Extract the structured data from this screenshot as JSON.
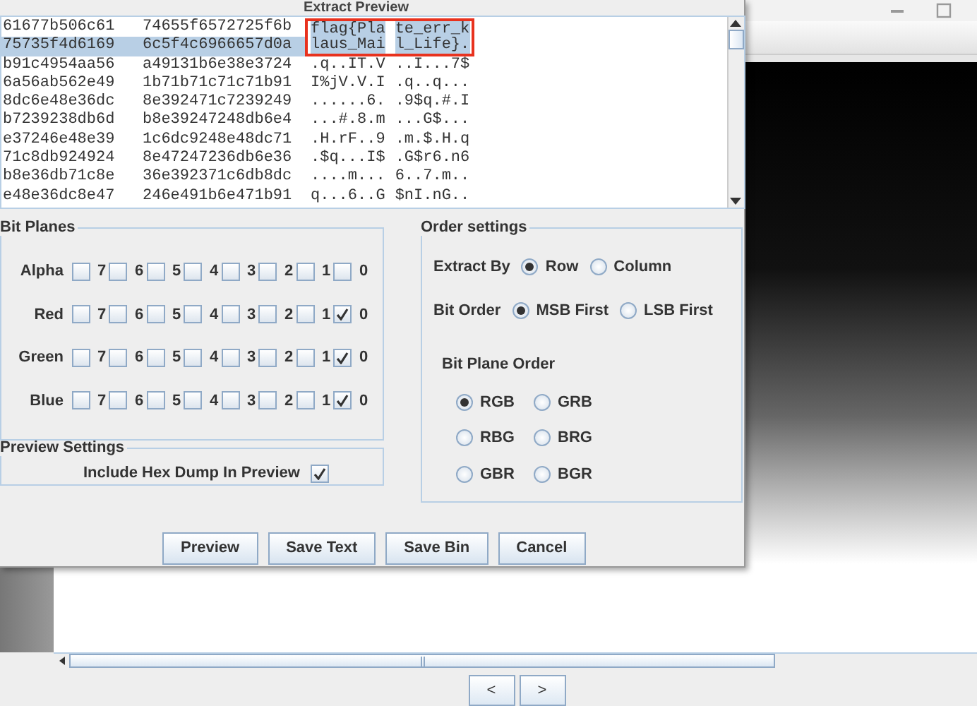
{
  "extract_preview": {
    "title": "Extract Preview",
    "rows": [
      {
        "hex_1": "61677b506c61",
        "hex_2": "74655f6572725f6b",
        "ascii_1": "flag{Pla",
        "ascii_2": "te_err_k",
        "hex_selected": false,
        "ascii_selected": true,
        "annotated": true
      },
      {
        "hex_1": "75735f4d6169",
        "hex_2": "6c5f4c6966657d0a",
        "ascii_1": "laus_Mai",
        "ascii_2": "l_Life}.",
        "hex_selected": true,
        "ascii_selected": true,
        "annotated": true
      },
      {
        "hex_1": "b91c4954aa56",
        "hex_2": "a49131b6e38e3724",
        "ascii_1": ".q..IT.V",
        "ascii_2": "..I...7$",
        "hex_selected": false,
        "ascii_selected": false,
        "annotated": false
      },
      {
        "hex_1": "6a56ab562e49",
        "hex_2": "1b71b71c71c71b91",
        "ascii_1": "I%jV.V.I",
        "ascii_2": ".q..q...",
        "hex_selected": false,
        "ascii_selected": false,
        "annotated": false
      },
      {
        "hex_1": "8dc6e48e36dc",
        "hex_2": "8e392471c7239249",
        "ascii_1": "......6.",
        "ascii_2": ".9$q.#.I",
        "hex_selected": false,
        "ascii_selected": false,
        "annotated": false
      },
      {
        "hex_1": "b7239238db6d",
        "hex_2": "b8e39247248db6e4",
        "ascii_1": "...#.8.m",
        "ascii_2": "...G$...",
        "hex_selected": false,
        "ascii_selected": false,
        "annotated": false
      },
      {
        "hex_1": "e37246e48e39",
        "hex_2": "1c6dc9248e48dc71",
        "ascii_1": ".H.rF..9",
        "ascii_2": ".m.$.H.q",
        "hex_selected": false,
        "ascii_selected": false,
        "annotated": false
      },
      {
        "hex_1": "71c8db924924",
        "hex_2": "8e47247236db6e36",
        "ascii_1": ".$q...I$",
        "ascii_2": ".G$r6.n6",
        "hex_selected": false,
        "ascii_selected": false,
        "annotated": false
      },
      {
        "hex_1": "b8e36db71c8e",
        "hex_2": "36e392371c6db8dc",
        "ascii_1": "....m...",
        "ascii_2": "6..7.m..",
        "hex_selected": false,
        "ascii_selected": false,
        "annotated": false
      },
      {
        "hex_1": "e48e36dc8e47",
        "hex_2": "246e491b6e471b91",
        "ascii_1": "q...6..G",
        "ascii_2": "$nI.nG..",
        "hex_selected": false,
        "ascii_selected": false,
        "annotated": false
      }
    ]
  },
  "bit_planes": {
    "title": "Bit Planes",
    "channels": [
      {
        "name": "Alpha",
        "bits": [
          {
            "label": "7",
            "checked": false
          },
          {
            "label": "6",
            "checked": false
          },
          {
            "label": "5",
            "checked": false
          },
          {
            "label": "4",
            "checked": false
          },
          {
            "label": "3",
            "checked": false
          },
          {
            "label": "2",
            "checked": false
          },
          {
            "label": "1",
            "checked": false
          },
          {
            "label": "0",
            "checked": false
          }
        ]
      },
      {
        "name": "Red",
        "bits": [
          {
            "label": "7",
            "checked": false
          },
          {
            "label": "6",
            "checked": false
          },
          {
            "label": "5",
            "checked": false
          },
          {
            "label": "4",
            "checked": false
          },
          {
            "label": "3",
            "checked": false
          },
          {
            "label": "2",
            "checked": false
          },
          {
            "label": "1",
            "checked": false
          },
          {
            "label": "0",
            "checked": true
          }
        ]
      },
      {
        "name": "Green",
        "bits": [
          {
            "label": "7",
            "checked": false
          },
          {
            "label": "6",
            "checked": false
          },
          {
            "label": "5",
            "checked": false
          },
          {
            "label": "4",
            "checked": false
          },
          {
            "label": "3",
            "checked": false
          },
          {
            "label": "2",
            "checked": false
          },
          {
            "label": "1",
            "checked": false
          },
          {
            "label": "0",
            "checked": true
          }
        ]
      },
      {
        "name": "Blue",
        "bits": [
          {
            "label": "7",
            "checked": false
          },
          {
            "label": "6",
            "checked": false
          },
          {
            "label": "5",
            "checked": false
          },
          {
            "label": "4",
            "checked": false
          },
          {
            "label": "3",
            "checked": false
          },
          {
            "label": "2",
            "checked": false
          },
          {
            "label": "1",
            "checked": false
          },
          {
            "label": "0",
            "checked": true
          }
        ]
      }
    ]
  },
  "preview_settings": {
    "title": "Preview Settings",
    "include_hex_dump": {
      "label": "Include Hex Dump In Preview",
      "checked": true
    }
  },
  "order_settings": {
    "title": "Order settings",
    "extract_by": {
      "label": "Extract By",
      "options": [
        {
          "label": "Row",
          "selected": true
        },
        {
          "label": "Column",
          "selected": false
        }
      ]
    },
    "bit_order": {
      "label": "Bit Order",
      "options": [
        {
          "label": "MSB First",
          "selected": true
        },
        {
          "label": "LSB First",
          "selected": false
        }
      ]
    },
    "bit_plane_order": {
      "title": "Bit Plane Order",
      "options": [
        {
          "label": "RGB",
          "selected": true
        },
        {
          "label": "GRB",
          "selected": false
        },
        {
          "label": "RBG",
          "selected": false
        },
        {
          "label": "BRG",
          "selected": false
        },
        {
          "label": "GBR",
          "selected": false
        },
        {
          "label": "BGR",
          "selected": false
        }
      ]
    }
  },
  "buttons": [
    "Preview",
    "Save Text",
    "Save Bin",
    "Cancel"
  ],
  "background_window": {
    "nav_buttons": [
      "<",
      ">"
    ]
  }
}
